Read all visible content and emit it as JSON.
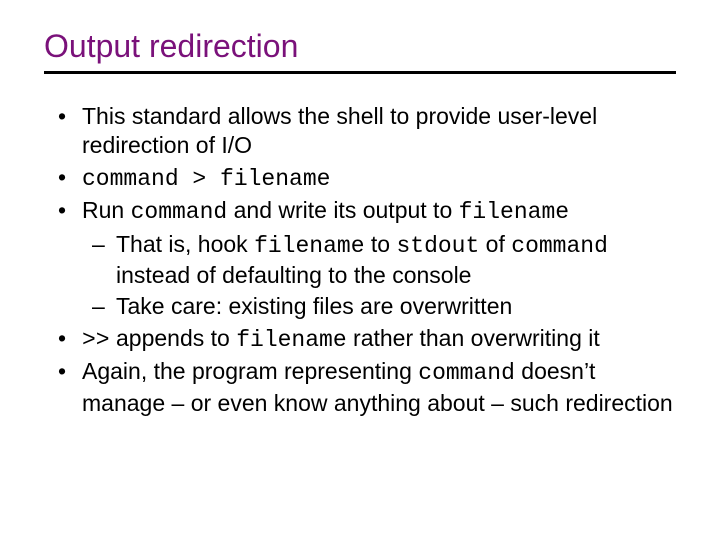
{
  "title": "Output redirection",
  "b1": "This standard allows the shell to provide user-level redirection of I/O",
  "b2": "command > filename",
  "b3a": "Run ",
  "b3b": "command",
  "b3c": " and write its output to ",
  "b3d": "filename",
  "s1a": "That is, hook ",
  "s1b": "filename",
  "s1c": " to ",
  "s1d": "stdout",
  "s1e": " of ",
  "s1f": "command",
  "s1g": " instead of defaulting to the console",
  "s2": "Take care: existing files are overwritten",
  "b4a": " >>",
  "b4b": " appends to ",
  "b4c": "filename",
  "b4d": " rather than overwriting it",
  "b5a": "Again, the program representing ",
  "b5b": "command",
  "b5c": " doesn’t manage – or even know anything about – such redirection"
}
